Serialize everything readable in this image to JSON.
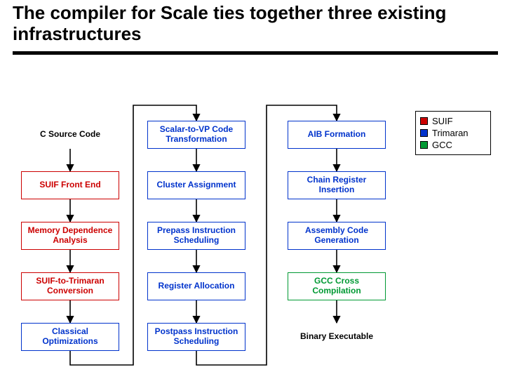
{
  "title": "The compiler for Scale ties together three existing infrastructures",
  "legend": {
    "suif": "SUIF",
    "trimaran": "Trimaran",
    "gcc": "GCC"
  },
  "col1": {
    "r1": "C Source Code",
    "r2": "SUIF Front End",
    "r3": "Memory Dependence Analysis",
    "r4": "SUIF-to-Trimaran Conversion",
    "r5": "Classical Optimizations"
  },
  "col2": {
    "r1": "Scalar-to-VP Code Transformation",
    "r2": "Cluster Assignment",
    "r3": "Prepass Instruction Scheduling",
    "r4": "Register Allocation",
    "r5": "Postpass Instruction Scheduling"
  },
  "col3": {
    "r1": "AIB Formation",
    "r2": "Chain Register Insertion",
    "r3": "Assembly Code Generation",
    "r4": "GCC Cross Compilation",
    "r5": "Binary Executable"
  },
  "colors": {
    "suif": "#cc0000",
    "trimaran": "#0033cc",
    "gcc": "#009933"
  }
}
